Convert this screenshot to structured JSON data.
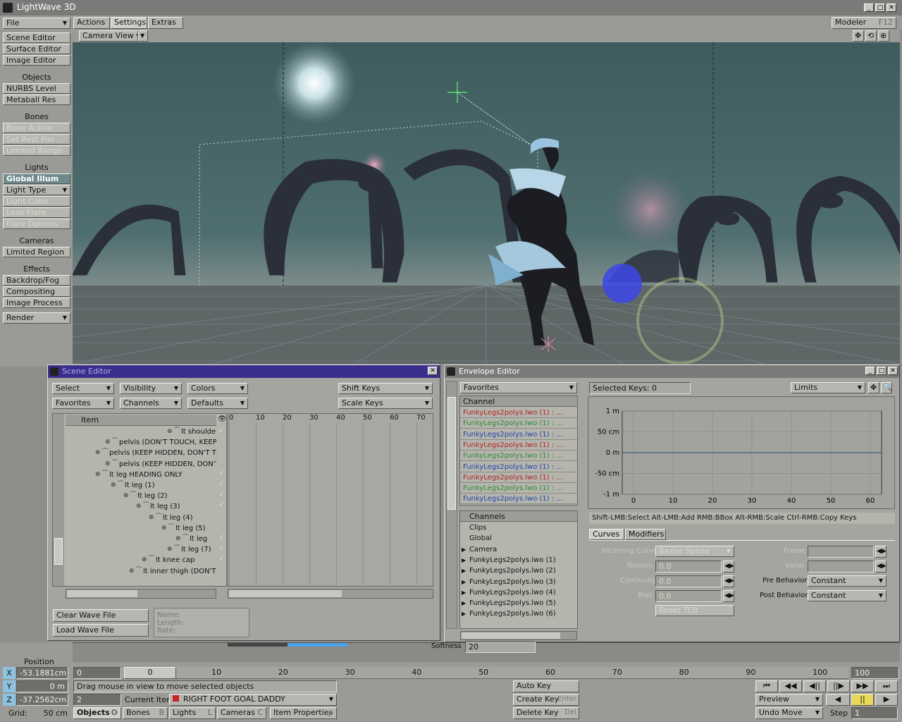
{
  "app": {
    "title": "LightWave 3D"
  },
  "tabs": [
    "Actions",
    "Settings",
    "Extras"
  ],
  "modeler_btn": {
    "label": "Modeler",
    "shortcut": "F12"
  },
  "viewport": {
    "mode": "Camera View"
  },
  "sidebar": {
    "file": "File",
    "editors": [
      "Scene Editor",
      "Surface Editor",
      "Image Editor"
    ],
    "objects_header": "Objects",
    "objects": [
      "NURBS Level",
      "Metaball Res"
    ],
    "bones_header": "Bones",
    "bones": [
      "Bone Active",
      "Set Rest Pos",
      "Limited Range"
    ],
    "lights_header": "Lights",
    "global_illum": "Global Illum",
    "light_type": "Light Type",
    "lights": [
      "Light Color",
      "Lens Flare",
      "Flare Options"
    ],
    "cameras_header": "Cameras",
    "limited_region": "Limited Region",
    "effects_header": "Effects",
    "effects": [
      "Backdrop/Fog",
      "Compositing",
      "Image Process"
    ],
    "render": "Render"
  },
  "scene_editor": {
    "title": "Scene Editor",
    "dropdowns_row1": [
      "Select",
      "Visibility",
      "Colors"
    ],
    "dropdowns_row2": [
      "Favorites",
      "Channels",
      "Defaults"
    ],
    "shift_keys": "Shift Keys",
    "scale_keys": "Scale Keys",
    "item_header": "Item",
    "timeline_ticks": [
      "0",
      "10",
      "20",
      "30",
      "40",
      "50",
      "60",
      "70"
    ],
    "items": [
      "lt shoulder",
      "pelvis (DON'T TOUCH, KEEP HIDDEN)",
      "pelvis  (KEEP HIDDEN, DON'T TOUCH)",
      "pelvis  (KEEP HIDDEN, DON'T TOUCH)",
      "lt leg HEADING ONLY",
      "lt leg (1)",
      "lt leg (2)",
      "lt leg (3)",
      "lt leg (4)",
      "lt leg (5)",
      "lt leg",
      "lt leg (7)",
      "lt knee cap",
      "lt inner thigh (DON'T TOUCH)"
    ],
    "clear_wave": "Clear Wave File",
    "load_wave": "Load Wave File",
    "wave_info": [
      "Name:",
      "Length:",
      "Rate:"
    ]
  },
  "envelope_editor": {
    "title": "Envelope Editor",
    "favorites": "Favorites",
    "channel_header": "Channel",
    "channels": [
      {
        "label": "FunkyLegs2polys.lwo (1) : ...",
        "color": "#b22222"
      },
      {
        "label": "FunkyLegs2polys.lwo (1) : ...",
        "color": "#2e8b2e"
      },
      {
        "label": "FunkyLegs2polys.lwo (1) : ...",
        "color": "#2244aa"
      },
      {
        "label": "FunkyLegs2polys.lwo (1) : ...",
        "color": "#b22222"
      },
      {
        "label": "FunkyLegs2polys.lwo (1) : ...",
        "color": "#2e8b2e"
      },
      {
        "label": "FunkyLegs2polys.lwo (1) : ...",
        "color": "#2244aa"
      },
      {
        "label": "FunkyLegs2polys.lwo (1) : ...",
        "color": "#b22222"
      },
      {
        "label": "FunkyLegs2polys.lwo (1) : ...",
        "color": "#2e8b2e"
      },
      {
        "label": "FunkyLegs2polys.lwo (1) : ...",
        "color": "#2244aa"
      }
    ],
    "channels_header": "Channels",
    "groups": [
      "Clips",
      "Global",
      "Camera",
      "FunkyLegs2polys.lwo (1)",
      "FunkyLegs2polys.lwo (2)",
      "FunkyLegs2polys.lwo (3)",
      "FunkyLegs2polys.lwo (4)",
      "FunkyLegs2polys.lwo (5)",
      "FunkyLegs2polys.lwo (6)"
    ],
    "selected_keys": "Selected Keys: 0",
    "limits": "Limits",
    "graph_y_labels": [
      "1 m",
      "50 cm",
      "0 m",
      "-50 cm",
      "-1 m"
    ],
    "graph_x_labels": [
      "0",
      "10",
      "20",
      "30",
      "40",
      "50",
      "60"
    ],
    "hint": "Shift-LMB:Select  Alt-LMB:Add  RMB:BBox  Alt-RMB:Scale  Ctrl-RMB:Copy Keys",
    "tabs": [
      "Curves",
      "Modifiers"
    ],
    "incoming_curve_label": "Incoming Curve",
    "incoming_curve": "Bezier Spline",
    "tension_label": "Tension",
    "tension": "0.0",
    "continuity_label": "Continuity",
    "continuity": "0.0",
    "bias_label": "Bias",
    "bias": "0.0",
    "reset_tcb": "Reset TCB",
    "frame_label": "Frame",
    "value_label": "Value",
    "pre_behavior_label": "Pre Behavior",
    "pre_behavior": "Constant",
    "post_behavior_label": "Post Behavior",
    "post_behavior": "Constant"
  },
  "bottom": {
    "softness_label": "Softness",
    "softness": "20",
    "position_label": "Position",
    "x_label": "X",
    "x_value": "-53.1881cm",
    "y_label": "Y",
    "y_value": "0 m",
    "z_label": "Z",
    "z_value": "-37.2562cm",
    "grid_label": "Grid:",
    "grid_value": "50 cm",
    "frame_start": "0",
    "frame_end": "100",
    "slider_frame": "0",
    "timeline_ticks": [
      "10",
      "20",
      "30",
      "40",
      "50",
      "60",
      "70",
      "80",
      "90",
      "100"
    ],
    "hint": "Drag mouse in view to move selected objects",
    "frame_field": "2",
    "current_item_label": "Current Item",
    "current_item": "RIGHT FOOT GOAL DADDY",
    "mode_tabs": [
      {
        "label": "Objects",
        "key": "O"
      },
      {
        "label": "Bones",
        "key": "B"
      },
      {
        "label": "Lights",
        "key": "L"
      },
      {
        "label": "Cameras",
        "key": "C"
      }
    ],
    "item_properties": "Item Properties",
    "item_properties_key": "p",
    "auto_key": "Auto Key",
    "create_key": "Create Key",
    "create_key_shortcut": "Enter",
    "delete_key": "Delete Key",
    "delete_key_shortcut": "Del",
    "preview": "Preview",
    "undo_move": "Undo Move",
    "step_label": "Step",
    "step_value": "1"
  },
  "colors": {
    "titlebar_active": "#3a2e8c",
    "titlebar_inactive": "#7a7a78",
    "viewport_sky": "#3d5b5d",
    "accent_blue": "#8ec2e0"
  }
}
